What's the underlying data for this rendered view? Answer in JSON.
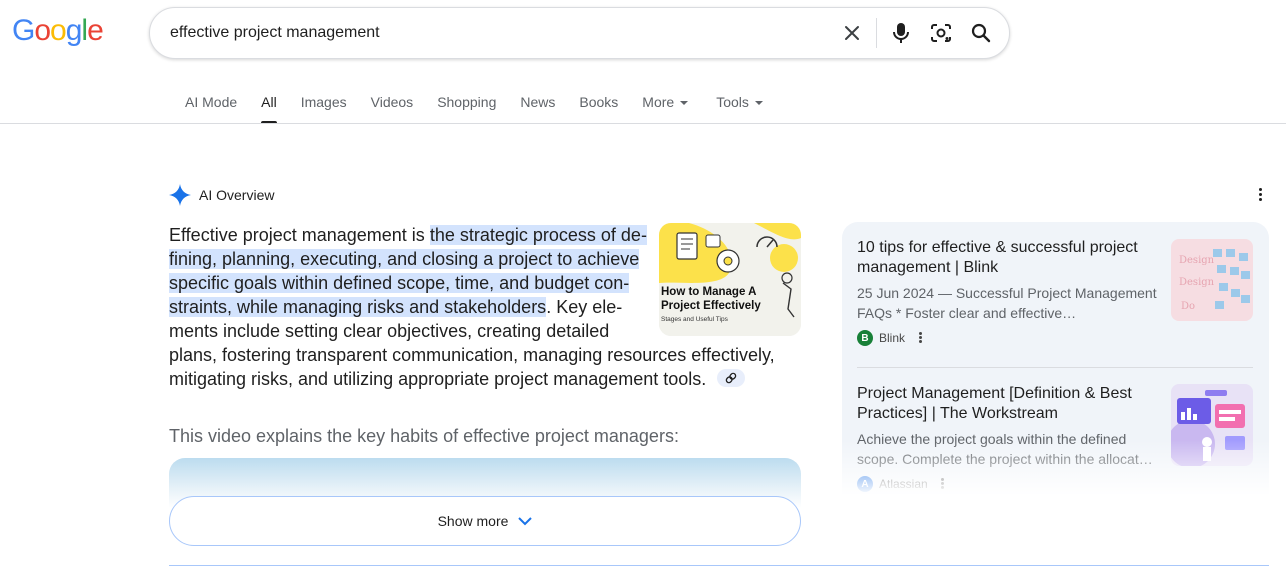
{
  "logo": {
    "text": [
      "G",
      "o",
      "o",
      "g",
      "l",
      "e"
    ],
    "colors": [
      "#4285f4",
      "#ea4335",
      "#fbbc05",
      "#4285f4",
      "#34a853",
      "#ea4335"
    ]
  },
  "search": {
    "query": "effective project management"
  },
  "tabs": [
    {
      "label": "AI Mode",
      "active": false
    },
    {
      "label": "All",
      "active": true
    },
    {
      "label": "Images",
      "active": false
    },
    {
      "label": "Videos",
      "active": false
    },
    {
      "label": "Shopping",
      "active": false
    },
    {
      "label": "News",
      "active": false
    },
    {
      "label": "Books",
      "active": false
    },
    {
      "label": "More",
      "active": false,
      "dropdown": true
    },
    {
      "label": "Tools",
      "active": false,
      "dropdown": true
    }
  ],
  "ai_overview": {
    "title": "AI Overview",
    "text_before": "Effective project management is ",
    "text_highlight": "the strategic process of de­fining, planning, executing, and closing a project to achieve specific goals within defined scope, time, and budget con­straints, while managing risks and stakeholders",
    "text_after": ". Key ele­ments include setting clear objectives, creating detailed plans, fostering transparent communication, managing re­sources effectively, mitigating risks, and utilizing appropriate project manage­ment tools.",
    "thumb_title": "How to Manage A Project Effectively",
    "thumb_sub": "Stages and Useful Tips",
    "video_caption": "This video explains the key habits of effective project managers:",
    "show_more": "Show more"
  },
  "sources": [
    {
      "title": "10 tips for effective & successful project management | Blink",
      "snippet": "25 Jun 2024 — Successful Project Management FAQs * Foster clear and effective…",
      "site": "Blink",
      "favicon_letter": "B"
    },
    {
      "title": "Project Management [Definition & Best Practices] | The Workstream",
      "snippet": "Achieve the project goals within the defined scope. Complete the project within the allocat…",
      "site": "Atlassian",
      "favicon_letter": "A"
    }
  ],
  "colors": {
    "accent": "#1a73e8",
    "highlight": "#d3e3fd",
    "panel": "#f0f4f9"
  }
}
